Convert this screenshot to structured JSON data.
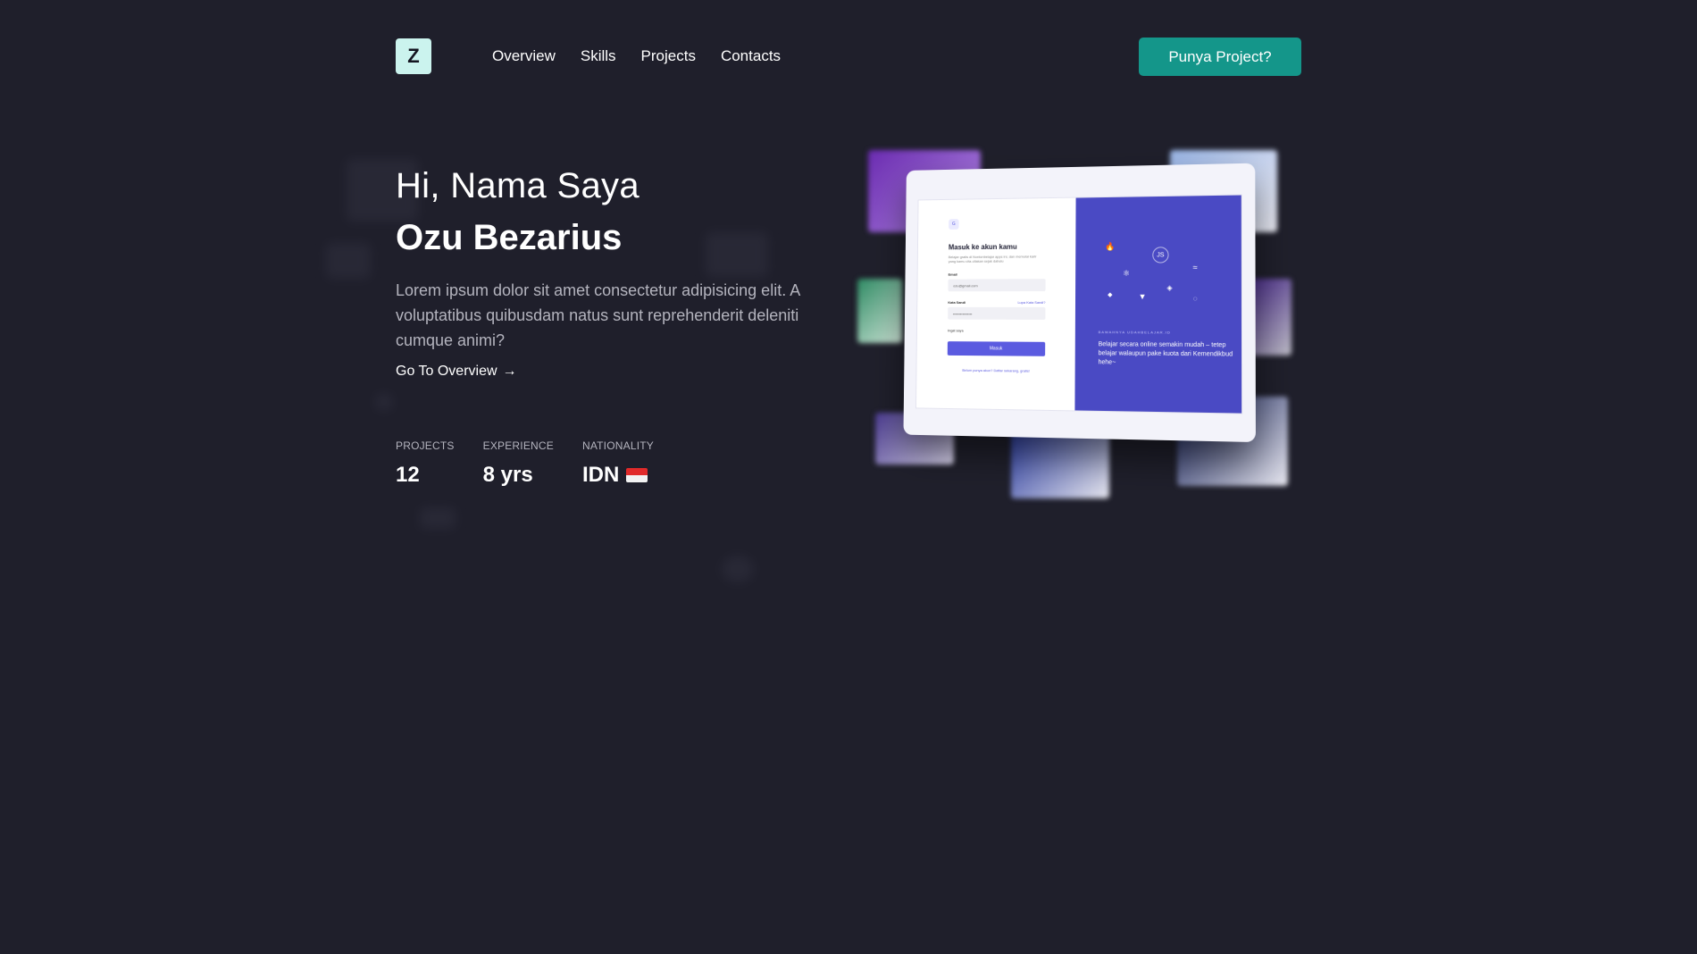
{
  "header": {
    "logo_letter": "Z",
    "nav": [
      "Overview",
      "Skills",
      "Projects",
      "Contacts"
    ],
    "cta_label": "Punya Project?"
  },
  "hero": {
    "greeting": "Hi, Nama Saya",
    "name": "Ozu Bezarius",
    "description": "Lorem ipsum dolor sit amet consectetur adipisicing elit. A voluptatibus quibusdam natus sunt reprehenderit deleniti cumque animi?",
    "link_label": "Go To Overview",
    "link_arrow": "→"
  },
  "stats": [
    {
      "label": "PROJECTS",
      "value": "12"
    },
    {
      "label": "EXPERIENCE",
      "value": "8 yrs"
    },
    {
      "label": "NATIONALITY",
      "value": "IDN"
    }
  ],
  "mockup": {
    "logo": "G",
    "title": "Masuk ke akun kamu",
    "subtitle": "Belajar gratis di Nontonbelajar apps ini, dan memulai karir yang kamu cita-citakan sejak dahulu",
    "email_label": "Email",
    "email_value": "ozu@gmail.com",
    "password_label": "Kata Sandi",
    "forgot_label": "Lupa Kata Sandi?",
    "password_value": "••••••••••••••••",
    "remember_label": "Ingat saya",
    "submit_label": "Masuk",
    "footer_text": "Belum punya akun? Daftar sekarang, gratis!",
    "right_caption": "BAWAHNYA UDAHBELAJAR.ID",
    "right_text": "Belajar secara online semakin mudah – tetep belajar walaupun pake kuota dari Kemendikbud hehe~"
  },
  "colors": {
    "background": "#1f1f2b",
    "accent": "#14968a",
    "logo_bg": "#cbf3ee",
    "mock_purple": "#4a4ac4"
  }
}
